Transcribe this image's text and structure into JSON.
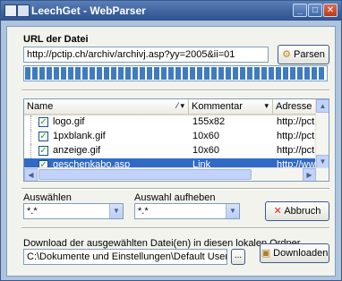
{
  "window": {
    "title": "LeechGet - WebParser"
  },
  "url_section": {
    "label": "URL der Datei",
    "url_value": "http://pctip.ch/archiv/archivj.asp?yy=2005&ii=01",
    "parse_button": "Parsen"
  },
  "progress": {
    "fraction": 1.0
  },
  "list": {
    "columns": [
      "Name",
      "Kommentar",
      "Adresse"
    ],
    "rows": [
      {
        "checked": true,
        "name": "logo.gif",
        "comment": "155x82",
        "address": "http://pctip."
      },
      {
        "checked": true,
        "name": "1pxblank.gif",
        "comment": "10x60",
        "address": "http://pctip."
      },
      {
        "checked": true,
        "name": "anzeige.gif",
        "comment": "10x60",
        "address": "http://pctip."
      },
      {
        "checked": true,
        "name": "geschenkabo.asp",
        "comment": "Link",
        "address": "http://www.",
        "selected": true
      }
    ]
  },
  "select_section": {
    "select_label": "Auswählen",
    "select_value": "*.*",
    "deselect_label": "Auswahl aufheben",
    "deselect_value": "*.*",
    "cancel_button": "Abbruch"
  },
  "download_section": {
    "label": "Download der ausgewählten Datei(en) in diesen lokalen Ordner",
    "folder_value": "C:\\Dokumente und Einstellungen\\Default User\\Desktop",
    "browse_button": "...",
    "download_button": "Downloaden"
  },
  "colors": {
    "selection": "#316ac5",
    "title_bar": "#3f649f",
    "cancel_icon": "#d42a1e"
  },
  "icons": [
    "app-icon",
    "gear-icon",
    "close-x-icon",
    "package-icon",
    "checkbox-checked-icon"
  ]
}
